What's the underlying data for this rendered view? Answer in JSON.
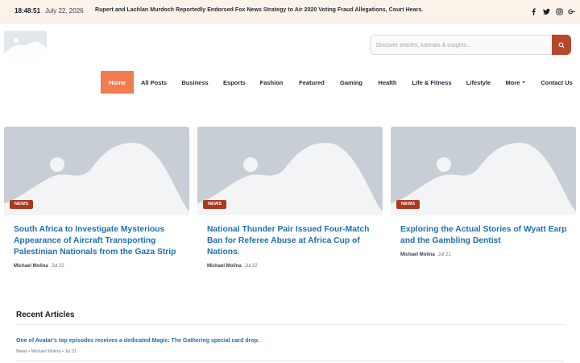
{
  "topbar": {
    "time": "18:48:51",
    "date": "July 22, 2026",
    "ticker": "Rupert and Lachlan Murdoch Reportedly Endorsed Fox News Strategy to Air 2020 Voting Fraud Allegations, Court Hears.",
    "social_icons": [
      "facebook-icon",
      "twitter-icon",
      "instagram-icon",
      "google-plus-icon"
    ]
  },
  "search": {
    "placeholder": "Discover articles, tutorials & insights...",
    "value": "",
    "button_icon": "search-icon"
  },
  "nav": {
    "items": [
      {
        "label": "Home",
        "active": true
      },
      {
        "label": "All Posts"
      },
      {
        "label": "Business"
      },
      {
        "label": "Esports"
      },
      {
        "label": "Fashion"
      },
      {
        "label": "Featured"
      },
      {
        "label": "Gaming"
      },
      {
        "label": "Health"
      },
      {
        "label": "Life & Fitness"
      },
      {
        "label": "Lifestyle"
      },
      {
        "label": "More",
        "dropdown": true
      },
      {
        "label": "Contact Us"
      }
    ]
  },
  "featured": [
    {
      "badge": "NEWS",
      "title": "South Africa to Investigate Mysterious Appearance of Aircraft Transporting Palestinian Nationals from the Gaza Strip",
      "author": "Michael Molina",
      "date": "Jul 22"
    },
    {
      "badge": "NEWS",
      "title": "National Thunder Pair Issued Four-Match Ban for Referee Abuse at Africa Cup of Nations.",
      "author": "Michael Molina",
      "date": "Jul 22"
    },
    {
      "badge": "NEWS",
      "title": "Exploring the Actual Stories of Wyatt Earp and the Gambling Dentist",
      "author": "Michael Molina",
      "date": "Jul 21"
    }
  ],
  "recent": {
    "heading": "Recent Articles",
    "items": [
      {
        "title": "One of Avatar's top episodes receives a dedicated Magic: The Gathering special card drop.",
        "meta": "News • Michael Molina • Jul 21"
      }
    ]
  },
  "colors": {
    "accent": "#f07c4f",
    "badge": "#a93a1c",
    "link": "#1f6fb2",
    "search_button": "#b7472a",
    "topbar_bg": "#fbf3ea"
  }
}
